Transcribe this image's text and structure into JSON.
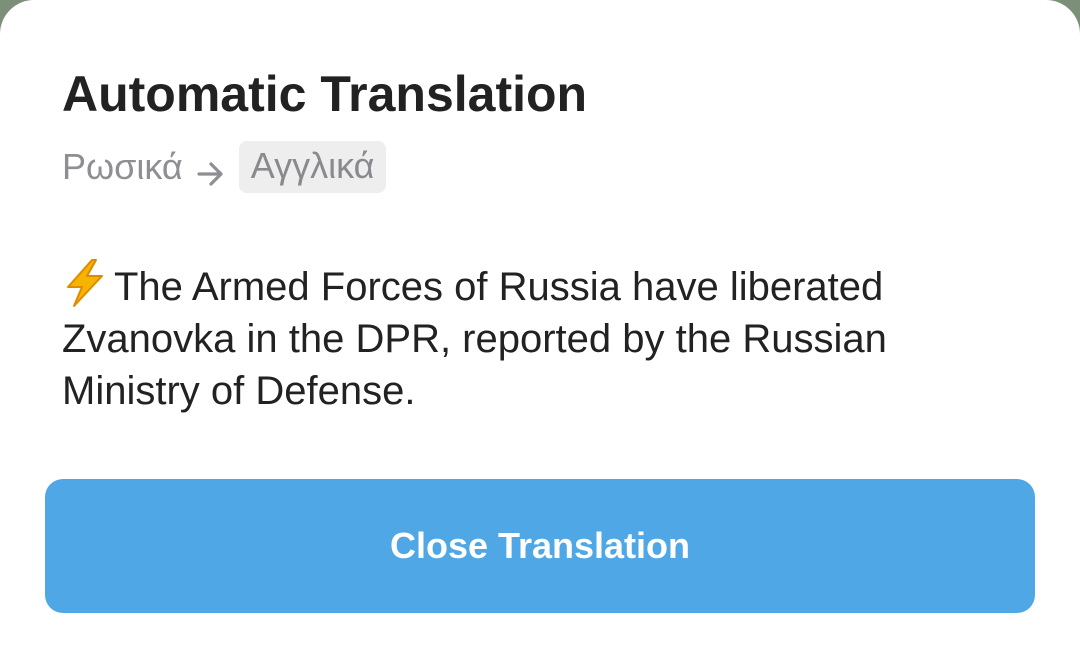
{
  "dialog": {
    "title": "Automatic Translation",
    "source_language": "Ρωσικά",
    "target_language": "Αγγλικά",
    "arrow_icon": "arrow-right-icon",
    "message_icon": "lightning-bolt-emoji",
    "message_text": "The Armed Forces of Russia have liberated Zvanovka in the DPR, reported by the Russian Ministry of Defense.",
    "close_button_label": "Close Translation"
  },
  "colors": {
    "accent": "#50a7e6",
    "title_text": "#222222",
    "secondary_text": "#8e8e93",
    "language_chip_bg": "#eeeeee",
    "backdrop": "#7c8f79"
  }
}
